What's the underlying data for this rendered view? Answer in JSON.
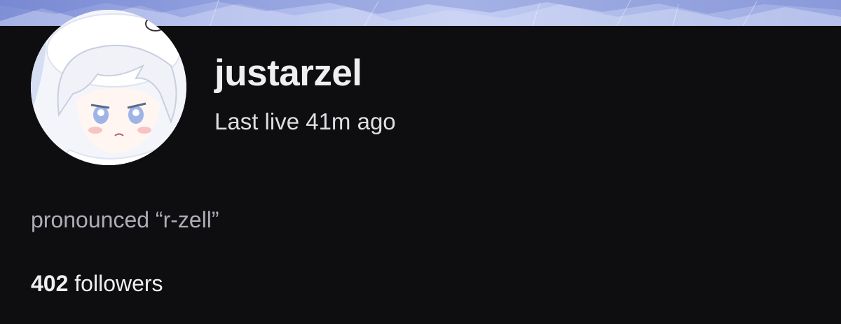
{
  "profile": {
    "username": "justarzel",
    "last_live": "Last live 41m ago",
    "bio": "pronounced “r-zell”",
    "followers": {
      "count": "402",
      "label": "followers"
    }
  },
  "icons": {
    "avatar": "chibi-avatar-image",
    "banner": "blue-sky-banner-image"
  },
  "colors": {
    "background": "#0e0e10",
    "banner": "#a9b6ea",
    "text_primary": "#efeff1",
    "text_secondary": "#adadb8"
  }
}
